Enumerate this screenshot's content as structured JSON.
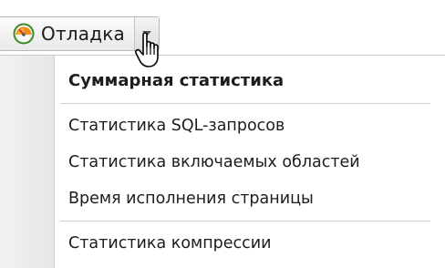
{
  "toolbar": {
    "debug_label": "Отладка",
    "debug_icon": "gauge-icon",
    "dropdown_icon": "chevron-down-icon"
  },
  "menu": {
    "items": [
      {
        "label": "Суммарная статистика",
        "bold": true
      },
      {
        "label": "Статистика SQL-запросов",
        "bold": false
      },
      {
        "label": "Статистика включаемых областей",
        "bold": false
      },
      {
        "label": "Время исполнения страницы",
        "bold": false
      },
      {
        "label": "Статистика компрессии",
        "bold": false
      }
    ]
  },
  "cursor": {
    "icon": "hand-pointer-icon"
  },
  "colors": {
    "icon_ring": "#5aa63a",
    "icon_face": "#f28a1c",
    "icon_needle": "#c0392b"
  }
}
